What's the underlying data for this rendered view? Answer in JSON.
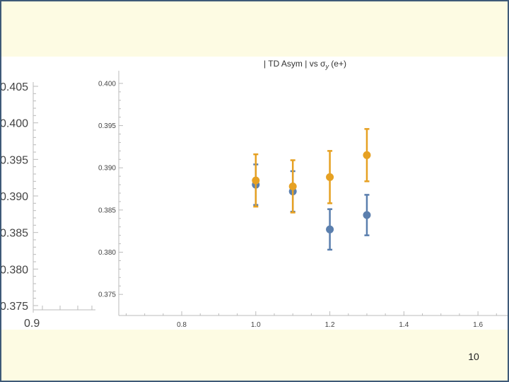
{
  "slide": {
    "page_number": "10"
  },
  "background_plot": {
    "y_ticks": [
      "0.405",
      "0.400",
      "0.395",
      "0.390",
      "0.385",
      "0.380",
      "0.375"
    ],
    "y_values": [
      0.405,
      0.4,
      0.395,
      0.39,
      0.385,
      0.38,
      0.375
    ],
    "x_tick": "0.9"
  },
  "chart_data": {
    "type": "scatter",
    "title_prefix": "| TD Asym | vs σ",
    "title_subscript": "y",
    "title_suffix": " (e+)",
    "xlim": [
      0.63,
      1.68
    ],
    "ylim": [
      0.3725,
      0.4015
    ],
    "x_ticks": [
      0.8,
      1.0,
      1.2,
      1.4,
      1.6
    ],
    "x_tick_labels": [
      "0.8",
      "1.0",
      "1.2",
      "1.4",
      "1.6"
    ],
    "y_ticks": [
      0.375,
      0.38,
      0.385,
      0.39,
      0.395,
      0.4
    ],
    "y_tick_labels": [
      "0.375",
      "0.380",
      "0.385",
      "0.390",
      "0.395",
      "0.400"
    ],
    "grid": false,
    "series": [
      {
        "color": "#5b7fae",
        "points": [
          {
            "x": 1.0,
            "y": 0.388,
            "err": 0.0024
          },
          {
            "x": 1.1,
            "y": 0.3872,
            "err": 0.0024
          },
          {
            "x": 1.2,
            "y": 0.3827,
            "err": 0.0024
          },
          {
            "x": 1.3,
            "y": 0.3844,
            "err": 0.0024
          }
        ]
      },
      {
        "color": "#e6a123",
        "points": [
          {
            "x": 1.0,
            "y": 0.3885,
            "err": 0.0031
          },
          {
            "x": 1.1,
            "y": 0.3878,
            "err": 0.0031
          },
          {
            "x": 1.2,
            "y": 0.3889,
            "err": 0.0031
          },
          {
            "x": 1.3,
            "y": 0.3915,
            "err": 0.0031
          }
        ]
      }
    ]
  }
}
